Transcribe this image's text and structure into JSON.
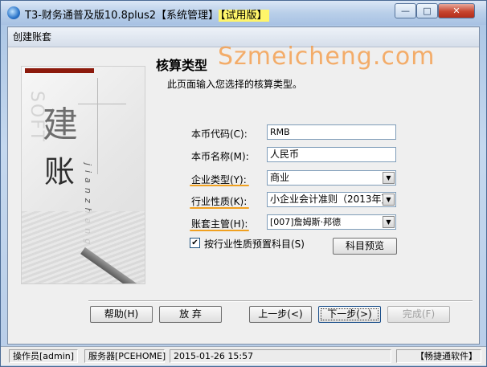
{
  "window": {
    "title_main": "T3-财务通普及版10.8plus2【系统管理】",
    "title_highlight": "【试用版】",
    "minimize_label": "—",
    "maximize_label": "□",
    "close_label": "✕"
  },
  "dialog": {
    "title": "创建账套",
    "section_title": "核算类型",
    "section_desc": "此页面输入您选择的核算类型。"
  },
  "side_image": {
    "char1": "建",
    "char2": "账",
    "pinyin": "jianzhang",
    "soft_text": "SOFT"
  },
  "fields": {
    "currency_code_label": "本币代码(C):",
    "currency_code_value": "RMB",
    "currency_name_label": "本币名称(M):",
    "currency_name_value": "人民币",
    "enterprise_type_label": "企业类型(Y):",
    "enterprise_type_value": "商业",
    "industry_nature_label": "行业性质(K):",
    "industry_nature_value": "小企业会计准则（2013年）",
    "account_supervisor_label": "账套主管(H):",
    "account_supervisor_value": "[007]詹姆斯·邦德"
  },
  "checkbox": {
    "preset_subjects_label": "按行业性质预置科目(S)",
    "checked": true
  },
  "buttons": {
    "preview_subjects": "科目预览",
    "help": "帮助(H)",
    "abandon": "放 弃",
    "previous": "上一步(<)",
    "next": "下一步(>)",
    "finish": "完成(F)"
  },
  "status_bar": {
    "operator": "操作员[admin]",
    "server": "服务器[PCEHOME]",
    "datetime": "2015-01-26 15:57",
    "company": "【畅捷通软件】"
  },
  "watermark": "Szmeicheng.com",
  "colors": {
    "underline_accent": "#f0a020",
    "title_highlight": "#fff56a",
    "side_red_bar": "#8c1a0c"
  }
}
